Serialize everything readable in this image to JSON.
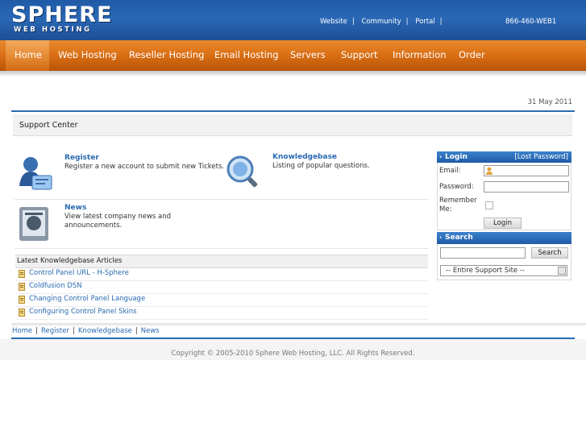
{
  "brand": {
    "logo_main_a": "S",
    "logo_main_b": "PHERE",
    "logo_sub": "WEB HOSTING"
  },
  "top_links": [
    "Website",
    "Community",
    "Portal"
  ],
  "top_sep": "|",
  "phone": "866-460-WEB1",
  "nav": [
    "Home",
    "Web Hosting",
    "Reseller Hosting",
    "Email Hosting",
    "Servers",
    "Support",
    "Information",
    "Order"
  ],
  "date": "31 May 2011",
  "support_center": "Support Center",
  "tiles": {
    "register": {
      "title": "Register",
      "desc": "Register a new account to submit new Tickets."
    },
    "knowledgebase": {
      "title": "Knowledgebase",
      "desc": "Listing of popular questions."
    },
    "news": {
      "title": "News",
      "desc": "View latest company news and announcements."
    }
  },
  "kb": {
    "heading": "Latest Knowledgebase Articles",
    "articles": [
      "Control Panel URL - H-Sphere",
      "Coldfusion DSN",
      "Changing Control Panel Language",
      "Configuring Control Panel Skins"
    ]
  },
  "login": {
    "title": "Login",
    "lost_password": "[Lost Password]",
    "email_label": "Email:",
    "password_label": "Password:",
    "remember_label_1": "Remember",
    "remember_label_2": "Me:",
    "button": "Login"
  },
  "search": {
    "title": "Search",
    "button": "Search",
    "scope": "-- Entire Support Site --"
  },
  "footer": {
    "links": [
      "Home",
      "Register",
      "Knowledgebase",
      "News"
    ],
    "sep": "|",
    "copyright": "Copyright © 2005-2010 Sphere Web Hosting, LLC. All Rights Reserved."
  },
  "colors": {
    "header_blue": "#1f5aa6",
    "nav_orange": "#d96e14",
    "link_blue": "#2a6ab0"
  }
}
